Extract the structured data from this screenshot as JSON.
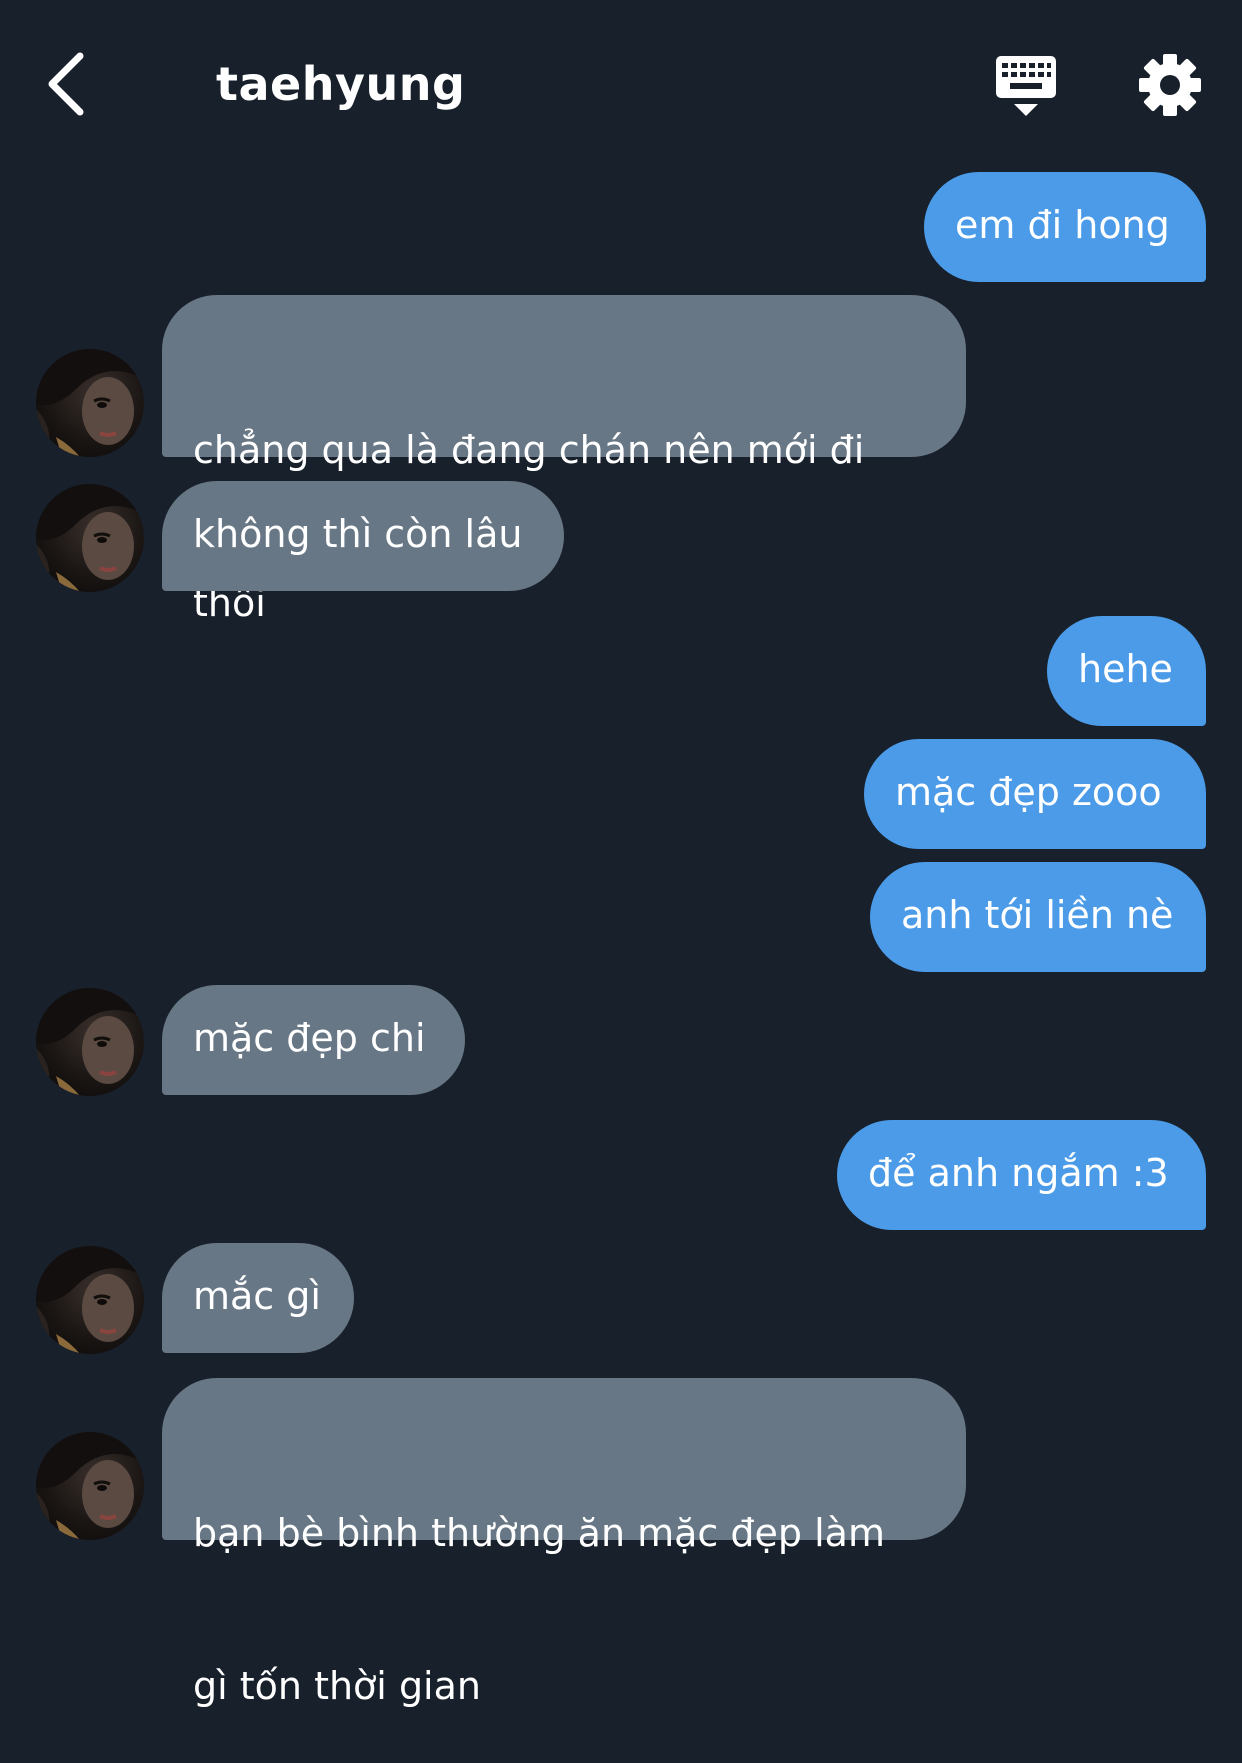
{
  "header": {
    "title": "taehyung",
    "back_icon": "chevron-left-icon",
    "keyboard_icon": "keyboard-hide-icon",
    "settings_icon": "gear-icon"
  },
  "colors": {
    "background": "#18202b",
    "sent_bubble": "#4b9be8",
    "received_bubble": "#687785",
    "text": "#ffffff"
  },
  "messages": [
    {
      "side": "sent",
      "text": "em đi hong"
    },
    {
      "side": "received",
      "text": "chẳng qua là đang chán nên mới đi thôi",
      "line1": "chẳng qua là đang chán nên mới đi",
      "line2": "thôi"
    },
    {
      "side": "received",
      "text": "không thì còn lâu"
    },
    {
      "side": "sent",
      "text": "hehe"
    },
    {
      "side": "sent",
      "text": "mặc đẹp zooo"
    },
    {
      "side": "sent",
      "text": "anh tới liền nè"
    },
    {
      "side": "received",
      "text": "mặc đẹp chi"
    },
    {
      "side": "sent",
      "text": "để anh ngắm :3"
    },
    {
      "side": "received",
      "text": "mắc gì"
    },
    {
      "side": "received",
      "text": "bạn bè bình thường ăn mặc đẹp làm gì tốn thời gian",
      "line1": "bạn bè bình thường ăn mặc đẹp làm",
      "line2": "gì tốn thời gian"
    }
  ]
}
